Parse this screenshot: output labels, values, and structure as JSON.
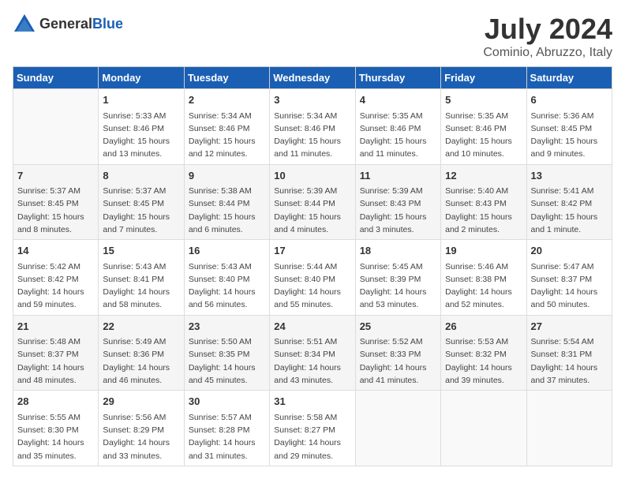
{
  "header": {
    "logo_general": "General",
    "logo_blue": "Blue",
    "title": "July 2024",
    "subtitle": "Cominio, Abruzzo, Italy"
  },
  "columns": [
    "Sunday",
    "Monday",
    "Tuesday",
    "Wednesday",
    "Thursday",
    "Friday",
    "Saturday"
  ],
  "weeks": [
    {
      "days": [
        {
          "num": "",
          "info": ""
        },
        {
          "num": "1",
          "info": "Sunrise: 5:33 AM\nSunset: 8:46 PM\nDaylight: 15 hours\nand 13 minutes."
        },
        {
          "num": "2",
          "info": "Sunrise: 5:34 AM\nSunset: 8:46 PM\nDaylight: 15 hours\nand 12 minutes."
        },
        {
          "num": "3",
          "info": "Sunrise: 5:34 AM\nSunset: 8:46 PM\nDaylight: 15 hours\nand 11 minutes."
        },
        {
          "num": "4",
          "info": "Sunrise: 5:35 AM\nSunset: 8:46 PM\nDaylight: 15 hours\nand 11 minutes."
        },
        {
          "num": "5",
          "info": "Sunrise: 5:35 AM\nSunset: 8:46 PM\nDaylight: 15 hours\nand 10 minutes."
        },
        {
          "num": "6",
          "info": "Sunrise: 5:36 AM\nSunset: 8:45 PM\nDaylight: 15 hours\nand 9 minutes."
        }
      ]
    },
    {
      "days": [
        {
          "num": "7",
          "info": "Sunrise: 5:37 AM\nSunset: 8:45 PM\nDaylight: 15 hours\nand 8 minutes."
        },
        {
          "num": "8",
          "info": "Sunrise: 5:37 AM\nSunset: 8:45 PM\nDaylight: 15 hours\nand 7 minutes."
        },
        {
          "num": "9",
          "info": "Sunrise: 5:38 AM\nSunset: 8:44 PM\nDaylight: 15 hours\nand 6 minutes."
        },
        {
          "num": "10",
          "info": "Sunrise: 5:39 AM\nSunset: 8:44 PM\nDaylight: 15 hours\nand 4 minutes."
        },
        {
          "num": "11",
          "info": "Sunrise: 5:39 AM\nSunset: 8:43 PM\nDaylight: 15 hours\nand 3 minutes."
        },
        {
          "num": "12",
          "info": "Sunrise: 5:40 AM\nSunset: 8:43 PM\nDaylight: 15 hours\nand 2 minutes."
        },
        {
          "num": "13",
          "info": "Sunrise: 5:41 AM\nSunset: 8:42 PM\nDaylight: 15 hours\nand 1 minute."
        }
      ]
    },
    {
      "days": [
        {
          "num": "14",
          "info": "Sunrise: 5:42 AM\nSunset: 8:42 PM\nDaylight: 14 hours\nand 59 minutes."
        },
        {
          "num": "15",
          "info": "Sunrise: 5:43 AM\nSunset: 8:41 PM\nDaylight: 14 hours\nand 58 minutes."
        },
        {
          "num": "16",
          "info": "Sunrise: 5:43 AM\nSunset: 8:40 PM\nDaylight: 14 hours\nand 56 minutes."
        },
        {
          "num": "17",
          "info": "Sunrise: 5:44 AM\nSunset: 8:40 PM\nDaylight: 14 hours\nand 55 minutes."
        },
        {
          "num": "18",
          "info": "Sunrise: 5:45 AM\nSunset: 8:39 PM\nDaylight: 14 hours\nand 53 minutes."
        },
        {
          "num": "19",
          "info": "Sunrise: 5:46 AM\nSunset: 8:38 PM\nDaylight: 14 hours\nand 52 minutes."
        },
        {
          "num": "20",
          "info": "Sunrise: 5:47 AM\nSunset: 8:37 PM\nDaylight: 14 hours\nand 50 minutes."
        }
      ]
    },
    {
      "days": [
        {
          "num": "21",
          "info": "Sunrise: 5:48 AM\nSunset: 8:37 PM\nDaylight: 14 hours\nand 48 minutes."
        },
        {
          "num": "22",
          "info": "Sunrise: 5:49 AM\nSunset: 8:36 PM\nDaylight: 14 hours\nand 46 minutes."
        },
        {
          "num": "23",
          "info": "Sunrise: 5:50 AM\nSunset: 8:35 PM\nDaylight: 14 hours\nand 45 minutes."
        },
        {
          "num": "24",
          "info": "Sunrise: 5:51 AM\nSunset: 8:34 PM\nDaylight: 14 hours\nand 43 minutes."
        },
        {
          "num": "25",
          "info": "Sunrise: 5:52 AM\nSunset: 8:33 PM\nDaylight: 14 hours\nand 41 minutes."
        },
        {
          "num": "26",
          "info": "Sunrise: 5:53 AM\nSunset: 8:32 PM\nDaylight: 14 hours\nand 39 minutes."
        },
        {
          "num": "27",
          "info": "Sunrise: 5:54 AM\nSunset: 8:31 PM\nDaylight: 14 hours\nand 37 minutes."
        }
      ]
    },
    {
      "days": [
        {
          "num": "28",
          "info": "Sunrise: 5:55 AM\nSunset: 8:30 PM\nDaylight: 14 hours\nand 35 minutes."
        },
        {
          "num": "29",
          "info": "Sunrise: 5:56 AM\nSunset: 8:29 PM\nDaylight: 14 hours\nand 33 minutes."
        },
        {
          "num": "30",
          "info": "Sunrise: 5:57 AM\nSunset: 8:28 PM\nDaylight: 14 hours\nand 31 minutes."
        },
        {
          "num": "31",
          "info": "Sunrise: 5:58 AM\nSunset: 8:27 PM\nDaylight: 14 hours\nand 29 minutes."
        },
        {
          "num": "",
          "info": ""
        },
        {
          "num": "",
          "info": ""
        },
        {
          "num": "",
          "info": ""
        }
      ]
    }
  ]
}
